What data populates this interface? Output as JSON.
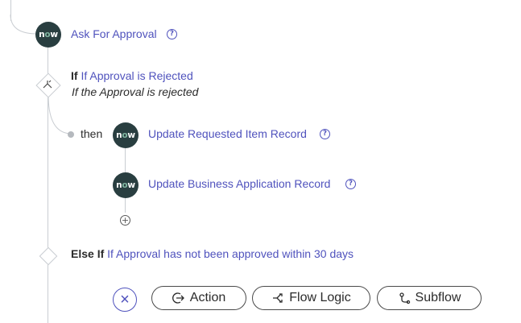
{
  "ask_approval": {
    "badge_text_pre": "n",
    "badge_text_o": "o",
    "badge_text_post": "w",
    "label": "Ask For Approval",
    "help_glyph": "?"
  },
  "if_block": {
    "keyword": "If",
    "condition": "If Approval is Rejected",
    "description": "If the Approval is rejected"
  },
  "then_label": "then",
  "steps": [
    {
      "label": "Update Requested Item Record",
      "help_glyph": "?"
    },
    {
      "label": "Update Business Application Record",
      "help_glyph": "?"
    }
  ],
  "add_glyph": "+",
  "else_if_block": {
    "keyword": "Else If",
    "condition": "If Approval has not been approved within 30 days"
  },
  "toolbar": {
    "close_glyph": "×",
    "action_label": "Action",
    "flow_logic_label": "Flow Logic",
    "subflow_label": "Subflow"
  },
  "icons": {
    "action": "action-icon",
    "flow_logic": "flow-logic-icon",
    "subflow": "subflow-icon"
  },
  "colors": {
    "link": "#4f52bd",
    "badge_bg": "#293e40",
    "badge_accent": "#81b5a1",
    "connector": "#c9cdd2"
  }
}
